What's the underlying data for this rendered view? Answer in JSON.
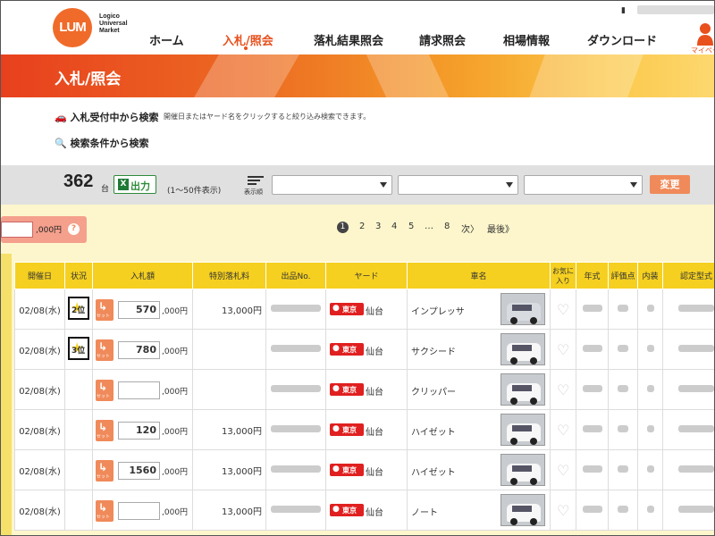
{
  "header": {
    "logo_mark": "LUM",
    "logo_text": [
      "Logico",
      "Universal",
      "Market"
    ],
    "nav": [
      "ホーム",
      "入札/照会",
      "落札結果照会",
      "請求照会",
      "相場情報",
      "ダウンロード"
    ],
    "active_nav": "入札/照会",
    "user_label": "マイページ"
  },
  "banner": {
    "title": "入札/照会"
  },
  "search": {
    "link1": "入札受付中から検索",
    "link1_note": "開催日またはヤード名をクリックすると絞り込み検索できます。",
    "link2": "検索条件から検索"
  },
  "controls": {
    "count": "362",
    "count_unit": "台",
    "excel_label": "出力",
    "range": "(1〜50件表示)",
    "sort_label": "表示順",
    "change_button": "変更"
  },
  "bulk": {
    "unit": ",000円",
    "help": "?"
  },
  "pagination": {
    "current": "1",
    "pages": [
      "2",
      "3",
      "4",
      "5"
    ],
    "ellipsis": "…",
    "last_page": "8",
    "next": "次〉",
    "last": "最後》"
  },
  "table": {
    "headers": [
      "開催日",
      "状況",
      "入札額",
      "特別落札料",
      "出品No.",
      "ヤード",
      "車名",
      "お気に入り",
      "年式",
      "評価点",
      "内装",
      "認定型式"
    ],
    "bid_unit": ",000円",
    "set_label": "セット",
    "rows": [
      {
        "date": "02/08(水)",
        "rank": "2位",
        "bid": "570",
        "fee": "13,000円",
        "yard": "東京",
        "city": "仙台",
        "car": "インプレッサ",
        "thumb": "silver"
      },
      {
        "date": "02/08(水)",
        "rank": "3位",
        "bid": "780",
        "fee": "",
        "yard": "東京",
        "city": "仙台",
        "car": "サクシード",
        "thumb": "white"
      },
      {
        "date": "02/08(水)",
        "rank": "",
        "bid": "",
        "fee": "",
        "yard": "東京",
        "city": "仙台",
        "car": "クリッパー",
        "thumb": "white"
      },
      {
        "date": "02/08(水)",
        "rank": "",
        "bid": "120",
        "fee": "13,000円",
        "yard": "東京",
        "city": "仙台",
        "car": "ハイゼット",
        "thumb": "white"
      },
      {
        "date": "02/08(水)",
        "rank": "",
        "bid": "1560",
        "fee": "13,000円",
        "yard": "東京",
        "city": "仙台",
        "car": "ハイゼット",
        "thumb": "white"
      },
      {
        "date": "02/08(水)",
        "rank": "",
        "bid": "",
        "fee": "13,000円",
        "yard": "東京",
        "city": "仙台",
        "car": "ノート",
        "thumb": "white"
      }
    ]
  },
  "colors": {
    "accent": "#e8501e",
    "header_yellow": "#f5d020",
    "button_salmon": "#f08a5a",
    "yard_red": "#e02020"
  }
}
